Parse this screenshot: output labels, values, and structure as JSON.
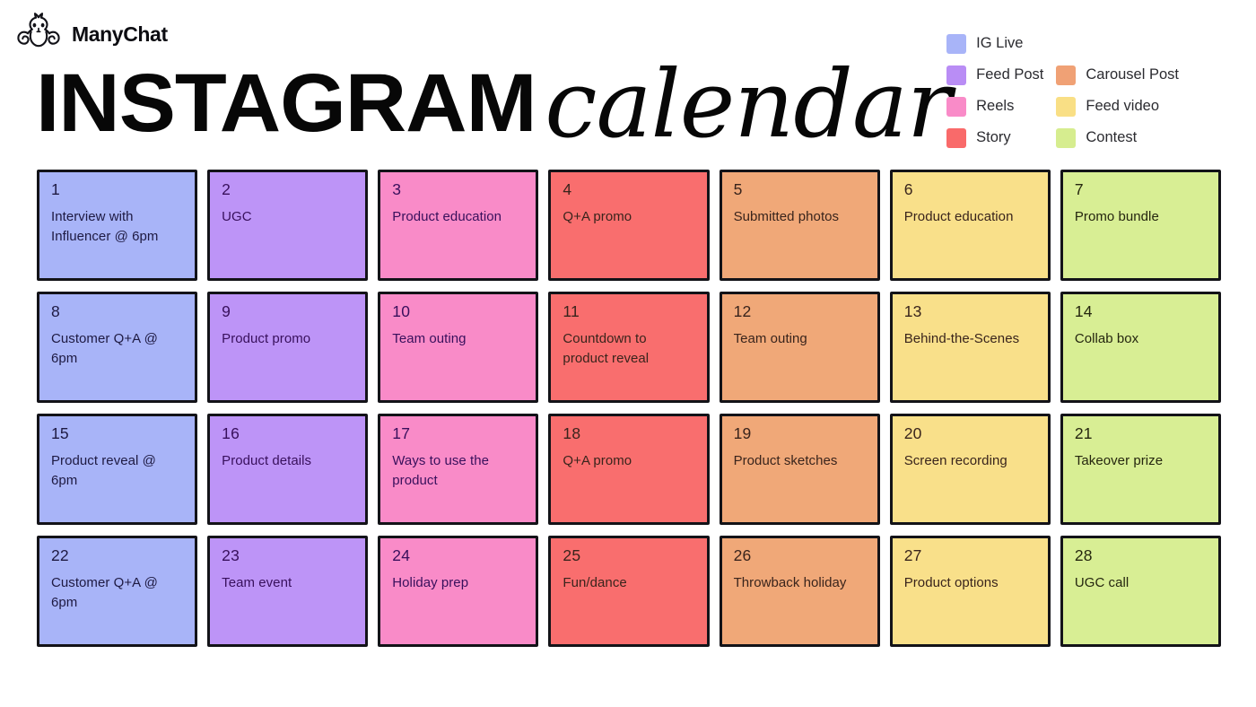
{
  "brand": {
    "name": "ManyChat",
    "logo_icon": "octopus-icon"
  },
  "header": {
    "title_main": "INSTAGRAM",
    "title_script": "calendar"
  },
  "legend": {
    "left": [
      {
        "label": "IG Live",
        "color": "#A8B4F8"
      },
      {
        "label": "Feed Post",
        "color": "#B98DF5"
      },
      {
        "label": "Reels",
        "color": "#F98BC8"
      },
      {
        "label": "Story",
        "color": "#F96A6A"
      }
    ],
    "right": [
      {
        "label": "",
        "color": ""
      },
      {
        "label": "Carousel Post",
        "color": "#F0A175"
      },
      {
        "label": "Feed video",
        "color": "#F9DF85"
      },
      {
        "label": "Contest",
        "color": "#D6ED8F"
      }
    ]
  },
  "colors": {
    "ig_live": "#A8B4F8",
    "feed_post": "#BD94F7",
    "reels": "#F98BC8",
    "story": "#F96E6E",
    "carousel_post": "#F0A878",
    "feed_video": "#F9E08A",
    "contest": "#D8EE94",
    "border": "#131318",
    "background": "#FFFFFF"
  },
  "calendar": {
    "cells": [
      {
        "day": "1",
        "text": "Interview with Influencer @ 6pm",
        "category": "IG Live",
        "color": "#A8B4F8",
        "tone": "tone-dark"
      },
      {
        "day": "2",
        "text": "UGC",
        "category": "Feed Post",
        "color": "#BD94F7",
        "tone": "tone-plum"
      },
      {
        "day": "3",
        "text": "Product education",
        "category": "Reels",
        "color": "#F98BC8",
        "tone": "tone-plum"
      },
      {
        "day": "4",
        "text": "Q+A promo",
        "category": "Story",
        "color": "#F96E6E",
        "tone": "tone-brown"
      },
      {
        "day": "5",
        "text": "Submitted photos",
        "category": "Carousel Post",
        "color": "#F0A878",
        "tone": "tone-brown"
      },
      {
        "day": "6",
        "text": "Product education",
        "category": "Feed video",
        "color": "#F9E08A",
        "tone": "tone-brown"
      },
      {
        "day": "7",
        "text": "Promo bundle",
        "category": "Contest",
        "color": "#D8EE94",
        "tone": "tone-olive"
      },
      {
        "day": "8",
        "text": "Customer Q+A @ 6pm",
        "category": "IG Live",
        "color": "#A8B4F8",
        "tone": "tone-dark"
      },
      {
        "day": "9",
        "text": "Product promo",
        "category": "Feed Post",
        "color": "#BD94F7",
        "tone": "tone-plum"
      },
      {
        "day": "10",
        "text": "Team outing",
        "category": "Reels",
        "color": "#F98BC8",
        "tone": "tone-plum"
      },
      {
        "day": "11",
        "text": "Countdown to product reveal",
        "category": "Story",
        "color": "#F96E6E",
        "tone": "tone-brown"
      },
      {
        "day": "12",
        "text": "Team outing",
        "category": "Carousel Post",
        "color": "#F0A878",
        "tone": "tone-brown"
      },
      {
        "day": "13",
        "text": "Behind-the-Scenes",
        "category": "Feed video",
        "color": "#F9E08A",
        "tone": "tone-brown"
      },
      {
        "day": "14",
        "text": "Collab box",
        "category": "Contest",
        "color": "#D8EE94",
        "tone": "tone-olive"
      },
      {
        "day": "15",
        "text": "Product reveal @ 6pm",
        "category": "IG Live",
        "color": "#A8B4F8",
        "tone": "tone-dark"
      },
      {
        "day": "16",
        "text": "Product details",
        "category": "Feed Post",
        "color": "#BD94F7",
        "tone": "tone-plum"
      },
      {
        "day": "17",
        "text": "Ways to use the product",
        "category": "Reels",
        "color": "#F98BC8",
        "tone": "tone-plum"
      },
      {
        "day": "18",
        "text": "Q+A promo",
        "category": "Story",
        "color": "#F96E6E",
        "tone": "tone-brown"
      },
      {
        "day": "19",
        "text": "Product sketches",
        "category": "Carousel Post",
        "color": "#F0A878",
        "tone": "tone-brown"
      },
      {
        "day": "20",
        "text": "Screen recording",
        "category": "Feed video",
        "color": "#F9E08A",
        "tone": "tone-brown"
      },
      {
        "day": "21",
        "text": "Takeover prize",
        "category": "Contest",
        "color": "#D8EE94",
        "tone": "tone-olive"
      },
      {
        "day": "22",
        "text": "Customer Q+A @ 6pm",
        "category": "IG Live",
        "color": "#A8B4F8",
        "tone": "tone-dark"
      },
      {
        "day": "23",
        "text": "Team event",
        "category": "Feed Post",
        "color": "#BD94F7",
        "tone": "tone-plum"
      },
      {
        "day": "24",
        "text": "Holiday prep",
        "category": "Reels",
        "color": "#F98BC8",
        "tone": "tone-plum"
      },
      {
        "day": "25",
        "text": "Fun/dance",
        "category": "Story",
        "color": "#F96E6E",
        "tone": "tone-brown"
      },
      {
        "day": "26",
        "text": "Throwback holiday",
        "category": "Carousel Post",
        "color": "#F0A878",
        "tone": "tone-brown"
      },
      {
        "day": "27",
        "text": "Product options",
        "category": "Feed video",
        "color": "#F9E08A",
        "tone": "tone-brown"
      },
      {
        "day": "28",
        "text": "UGC call",
        "category": "Contest",
        "color": "#D8EE94",
        "tone": "tone-olive"
      }
    ]
  }
}
